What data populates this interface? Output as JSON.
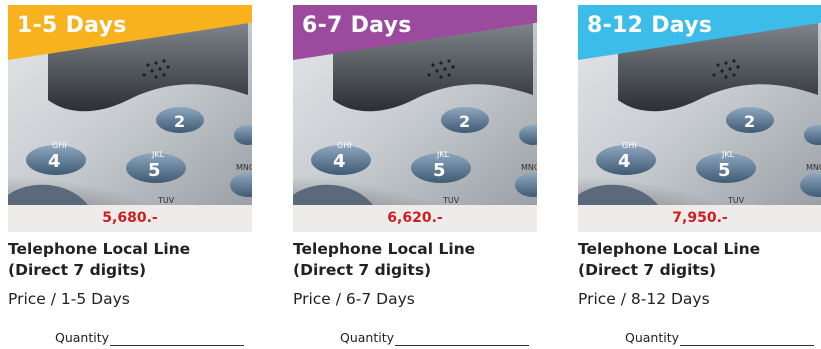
{
  "products": [
    {
      "duration": "1-5 Days",
      "banner_color": "#f7b21e",
      "price": "5,680.-",
      "title_line1": "Telephone Local Line",
      "title_line2": "(Direct 7 digits)",
      "subtitle": "Price / 1-5 Days",
      "quantity_label": "Quantity"
    },
    {
      "duration": "6-7 Days",
      "banner_color": "#9b4a9e",
      "price": "6,620.-",
      "title_line1": "Telephone Local Line",
      "title_line2": "(Direct 7 digits)",
      "subtitle": "Price / 6-7 Days",
      "quantity_label": "Quantity"
    },
    {
      "duration": "8-12 Days",
      "banner_color": "#3cbde9",
      "price": "7,950.-",
      "title_line1": "Telephone Local Line",
      "title_line2": "(Direct 7 digits)",
      "subtitle": "Price / 8-12 Days",
      "quantity_label": "Quantity"
    }
  ],
  "photo": {
    "key_labels": [
      "GHI",
      "4",
      "2",
      "JKL",
      "5",
      "TUV",
      "MNO"
    ]
  },
  "colors": {
    "price_text": "#cc1f1f",
    "price_bar_bg": "#eeecea"
  }
}
